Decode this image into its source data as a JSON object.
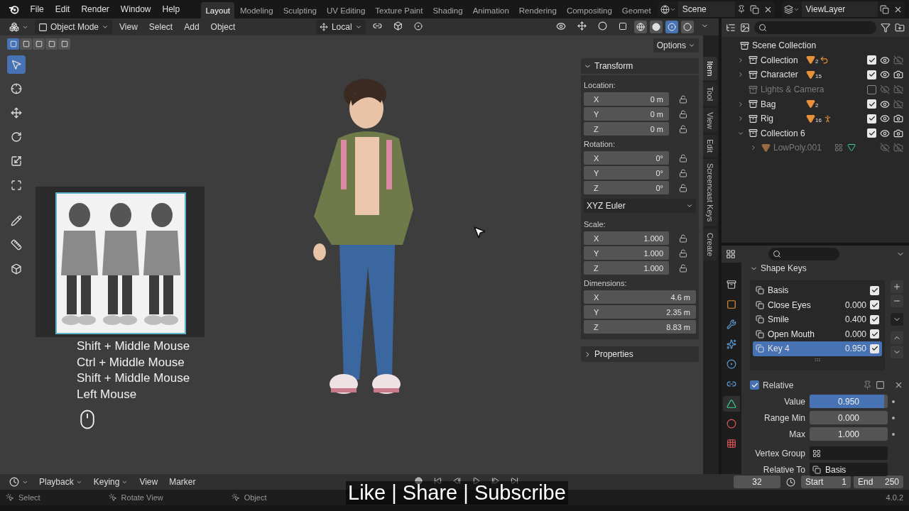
{
  "menu": [
    "File",
    "Edit",
    "Render",
    "Window",
    "Help"
  ],
  "workspaces": [
    {
      "label": "Layout",
      "selected": true
    },
    {
      "label": "Modeling",
      "selected": false
    },
    {
      "label": "Sculpting",
      "selected": false
    },
    {
      "label": "UV Editing",
      "selected": false
    },
    {
      "label": "Texture Paint",
      "selected": false
    },
    {
      "label": "Shading",
      "selected": false
    },
    {
      "label": "Animation",
      "selected": false
    },
    {
      "label": "Rendering",
      "selected": false
    },
    {
      "label": "Compositing",
      "selected": false
    },
    {
      "label": "Geomet",
      "selected": false
    }
  ],
  "scene": {
    "name": "Scene"
  },
  "view_layer": {
    "name": "ViewLayer"
  },
  "viewport_header": {
    "mode": "Object Mode",
    "menus": [
      "View",
      "Select",
      "Add",
      "Object"
    ],
    "transform_orientation": "Local",
    "shading": [
      {
        "selected": false
      },
      {
        "selected": false
      },
      {
        "selected": true
      },
      {
        "selected": false
      }
    ]
  },
  "select_modes": [
    {
      "selected": true
    },
    {
      "selected": false
    },
    {
      "selected": false
    },
    {
      "selected": false
    },
    {
      "selected": false
    }
  ],
  "options": "Options",
  "tools": [
    {
      "kind": "select",
      "selected": true
    },
    {
      "kind": "cursor",
      "selected": false
    },
    {
      "kind": "move",
      "selected": false
    },
    {
      "kind": "rotate",
      "selected": false
    },
    {
      "kind": "scale",
      "selected": false
    },
    {
      "kind": "transform",
      "selected": false
    },
    {
      "kind": "annotate",
      "selected": false
    },
    {
      "kind": "measure",
      "selected": false
    },
    {
      "kind": "add_cube",
      "selected": false
    }
  ],
  "screencast_keys": [
    "Shift + Middle Mouse",
    "Ctrl + Middle Mouse",
    "Shift + Middle Mouse",
    "Left Mouse"
  ],
  "transform_panel": {
    "title": "Transform",
    "expanded": true,
    "groups": [
      {
        "label": "Location:",
        "fields": [
          {
            "axis": "X",
            "value": "0 m",
            "locked": false
          },
          {
            "axis": "Y",
            "value": "0 m",
            "locked": false
          },
          {
            "axis": "Z",
            "value": "0 m",
            "locked": false
          }
        ]
      },
      {
        "label": "Rotation:",
        "fields": [
          {
            "axis": "X",
            "value": "0°",
            "locked": false
          },
          {
            "axis": "Y",
            "value": "0°",
            "locked": false
          },
          {
            "axis": "Z",
            "value": "0°",
            "locked": false
          }
        ],
        "mode": "XYZ Euler"
      },
      {
        "label": "Scale:",
        "fields": [
          {
            "axis": "X",
            "value": "1.000",
            "locked": false
          },
          {
            "axis": "Y",
            "value": "1.000",
            "locked": false
          },
          {
            "axis": "Z",
            "value": "1.000",
            "locked": false
          }
        ]
      },
      {
        "label": "Dimensions:",
        "fields": [
          {
            "axis": "X",
            "value": "4.6 m"
          },
          {
            "axis": "Y",
            "value": "2.35 m"
          },
          {
            "axis": "Z",
            "value": "8.83 m"
          }
        ]
      }
    ],
    "next_section": {
      "title": "Properties",
      "expanded": false
    }
  },
  "sidebar_tabs": [
    {
      "label": "Item",
      "selected": true
    },
    {
      "label": "Tool",
      "selected": false
    },
    {
      "label": "View",
      "selected": false
    },
    {
      "label": "Edit",
      "selected": false
    },
    {
      "label": "Screencast Keys",
      "selected": false
    },
    {
      "label": "Create",
      "selected": false
    }
  ],
  "outliner": {
    "root": "Scene Collection",
    "items": [
      {
        "kind": "collection",
        "name": "Collection",
        "expanded": false,
        "checked": true,
        "visible": true,
        "renderable": false,
        "disabled": false,
        "contents": [
          {
            "kind": "mesh",
            "count": "2"
          },
          {
            "kind": "curve"
          }
        ]
      },
      {
        "kind": "collection",
        "name": "Character",
        "expanded": false,
        "checked": true,
        "visible": true,
        "renderable": true,
        "disabled": false,
        "contents": [
          {
            "kind": "mesh",
            "count": "15"
          }
        ]
      },
      {
        "kind": "collection",
        "name": "Lights & Camera",
        "checked": false,
        "visible": false,
        "renderable": false,
        "disabled": true
      },
      {
        "kind": "collection",
        "name": "Bag",
        "expanded": false,
        "checked": true,
        "visible": true,
        "renderable": false,
        "disabled": false,
        "contents": [
          {
            "kind": "mesh",
            "count": "2"
          }
        ]
      },
      {
        "kind": "collection",
        "name": "Rig",
        "expanded": false,
        "checked": true,
        "visible": true,
        "renderable": true,
        "disabled": false,
        "contents": [
          {
            "kind": "mesh",
            "count": "16"
          },
          {
            "kind": "armature"
          }
        ]
      },
      {
        "kind": "collection",
        "name": "Collection 6",
        "expanded": true,
        "checked": true,
        "visible": true,
        "renderable": true,
        "disabled": false,
        "children": [
          {
            "kind": "object",
            "name": "LowPoly.001",
            "expanded": false,
            "visible": false,
            "renderable": false,
            "disabled": true,
            "contents": [
              {
                "kind": "modifier"
              },
              {
                "kind": "mesh_data"
              }
            ]
          }
        ]
      }
    ]
  },
  "properties": {
    "tabs": [
      {
        "kind": "collection",
        "selected": false
      },
      {
        "kind": "object",
        "selected": false
      },
      {
        "kind": "modifiers",
        "selected": false
      },
      {
        "kind": "particles",
        "selected": false
      },
      {
        "kind": "physics",
        "selected": false
      },
      {
        "kind": "constraints",
        "selected": false
      },
      {
        "kind": "data",
        "selected": true
      },
      {
        "kind": "material",
        "selected": false
      },
      {
        "kind": "texture",
        "selected": false
      }
    ],
    "section": {
      "title": "Shape Keys",
      "expanded": true
    },
    "shape_keys": [
      {
        "name": "Basis",
        "checked": true,
        "selected": false
      },
      {
        "name": "Close Eyes",
        "value": "0.000",
        "checked": true,
        "selected": false
      },
      {
        "name": "Smile",
        "value": "0.400",
        "checked": true,
        "selected": false
      },
      {
        "name": "Open Mouth",
        "value": "0.000",
        "checked": true,
        "selected": false
      },
      {
        "name": "Key 4",
        "value": "0.950",
        "checked": true,
        "selected": true
      }
    ],
    "relative": {
      "label": "Relative",
      "checked": true
    },
    "fields": [
      {
        "kind": "slider",
        "label": "Value",
        "value": "0.950",
        "level": 0.95
      },
      {
        "kind": "number",
        "label": "Range Min",
        "value": "0.000"
      },
      {
        "kind": "number",
        "label": "Max",
        "value": "1.000"
      },
      {
        "kind": "search",
        "label": "Vertex Group"
      },
      {
        "kind": "search",
        "label": "Relative To",
        "value": "Basis"
      }
    ]
  },
  "timeline": {
    "menus": [
      "Playback",
      "Keying",
      "View",
      "Marker"
    ],
    "current_frame": "32",
    "start": {
      "label": "Start",
      "value": "1"
    },
    "end": {
      "label": "End",
      "value": "250"
    }
  },
  "status_bar": {
    "hints": [
      "Select",
      "Rotate View",
      "Object"
    ],
    "version": "4.0.2"
  },
  "caption": "Like | Share | Subscribe"
}
